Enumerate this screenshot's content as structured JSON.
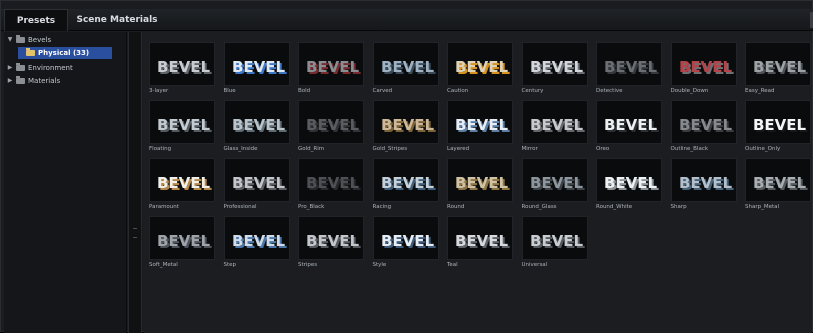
{
  "tabs": [
    {
      "label": "Presets",
      "active": true
    },
    {
      "label": "Scene Materials",
      "active": false
    }
  ],
  "tree": [
    {
      "label": "Bevels",
      "expanded": true,
      "level": 0,
      "selected": false
    },
    {
      "label": "Physical (33)",
      "expanded": false,
      "level": 1,
      "selected": true
    },
    {
      "label": "Environment",
      "expanded": false,
      "level": 0,
      "selected": false
    },
    {
      "label": "Materials",
      "expanded": false,
      "level": 0,
      "selected": false
    }
  ],
  "thumb_text": "BEVEL",
  "presets": [
    {
      "name": "3-layer",
      "face": "#c9ccd0",
      "side": "#5e6368"
    },
    {
      "name": "Blue",
      "face": "#dfe8f4",
      "side": "#3d78c8"
    },
    {
      "name": "Bold",
      "face": "#8a8d92",
      "side": "#7a2a2e"
    },
    {
      "name": "Carved",
      "face": "#9fb2c4",
      "side": "#3a4a58"
    },
    {
      "name": "Caution",
      "face": "#ddd3b8",
      "side": "#d8921e"
    },
    {
      "name": "Century",
      "face": "#d3d6da",
      "side": "#6a6e74"
    },
    {
      "name": "Detective",
      "face": "#6b6f74",
      "side": "#34373b"
    },
    {
      "name": "Double_Down",
      "face": "#b44248",
      "side": "#6e6f73"
    },
    {
      "name": "Easy_Read",
      "face": "#9ea3a7",
      "side": "#4e5256"
    },
    {
      "name": "Floating",
      "face": "#c3cbd2",
      "side": "#545a60"
    },
    {
      "name": "Glass_Inside",
      "face": "#b8c4cc",
      "side": "#5f6a72"
    },
    {
      "name": "Gold_Rim",
      "face": "#595c60",
      "side": "#303236"
    },
    {
      "name": "Gold_Stripes",
      "face": "#cdb99a",
      "side": "#7a6238"
    },
    {
      "name": "Layered",
      "face": "#e7eef6",
      "side": "#5b7fa3"
    },
    {
      "name": "Mirror",
      "face": "#c7c9cc",
      "side": "#63666a"
    },
    {
      "name": "Oreo",
      "face": "#edf0f3",
      "side": "#2c2f33"
    },
    {
      "name": "Outline_Black",
      "face": "#86898d",
      "side": "#3a3c40"
    },
    {
      "name": "Outline_Only",
      "face": "#f4f6f8",
      "side": "#161719"
    },
    {
      "name": "Paramount",
      "face": "#f1efe8",
      "side": "#b4874a"
    },
    {
      "name": "Professional",
      "face": "#c2c5c9",
      "side": "#5a5e63"
    },
    {
      "name": "Pro_Black",
      "face": "#4d5054",
      "side": "#26282b"
    },
    {
      "name": "Racing",
      "face": "#c6d0d9",
      "side": "#3f5d78"
    },
    {
      "name": "Round",
      "face": "#d0c3a5",
      "side": "#8e7444"
    },
    {
      "name": "Round_Glass",
      "face": "#8d969d",
      "side": "#3c4248"
    },
    {
      "name": "Round_White",
      "face": "#eef1f4",
      "side": "#8d9297"
    },
    {
      "name": "Sharp",
      "face": "#b3c0cc",
      "side": "#476277"
    },
    {
      "name": "Sharp_Metal",
      "face": "#a9aeb3",
      "side": "#55595e"
    },
    {
      "name": "Soft_Metal",
      "face": "#9ea4aa",
      "side": "#4c5258"
    },
    {
      "name": "Step",
      "face": "#cfdcea",
      "side": "#4a76a8"
    },
    {
      "name": "Stripes",
      "face": "#c3c7cc",
      "side": "#565a60"
    },
    {
      "name": "Style",
      "face": "#e6edf4",
      "side": "#3e5a78"
    },
    {
      "name": "Teal",
      "face": "#d7dadd",
      "side": "#5d6167"
    },
    {
      "name": "Universal",
      "face": "#c9cdd1",
      "side": "#54595e"
    }
  ],
  "colors": {
    "selection": "#2a4f9e",
    "selected_folder": "#e2c36b",
    "folder": "#8b8f94"
  },
  "icons": {
    "expanded": "triangle-down-icon",
    "collapsed": "triangle-right-icon",
    "folder": "folder-icon"
  }
}
